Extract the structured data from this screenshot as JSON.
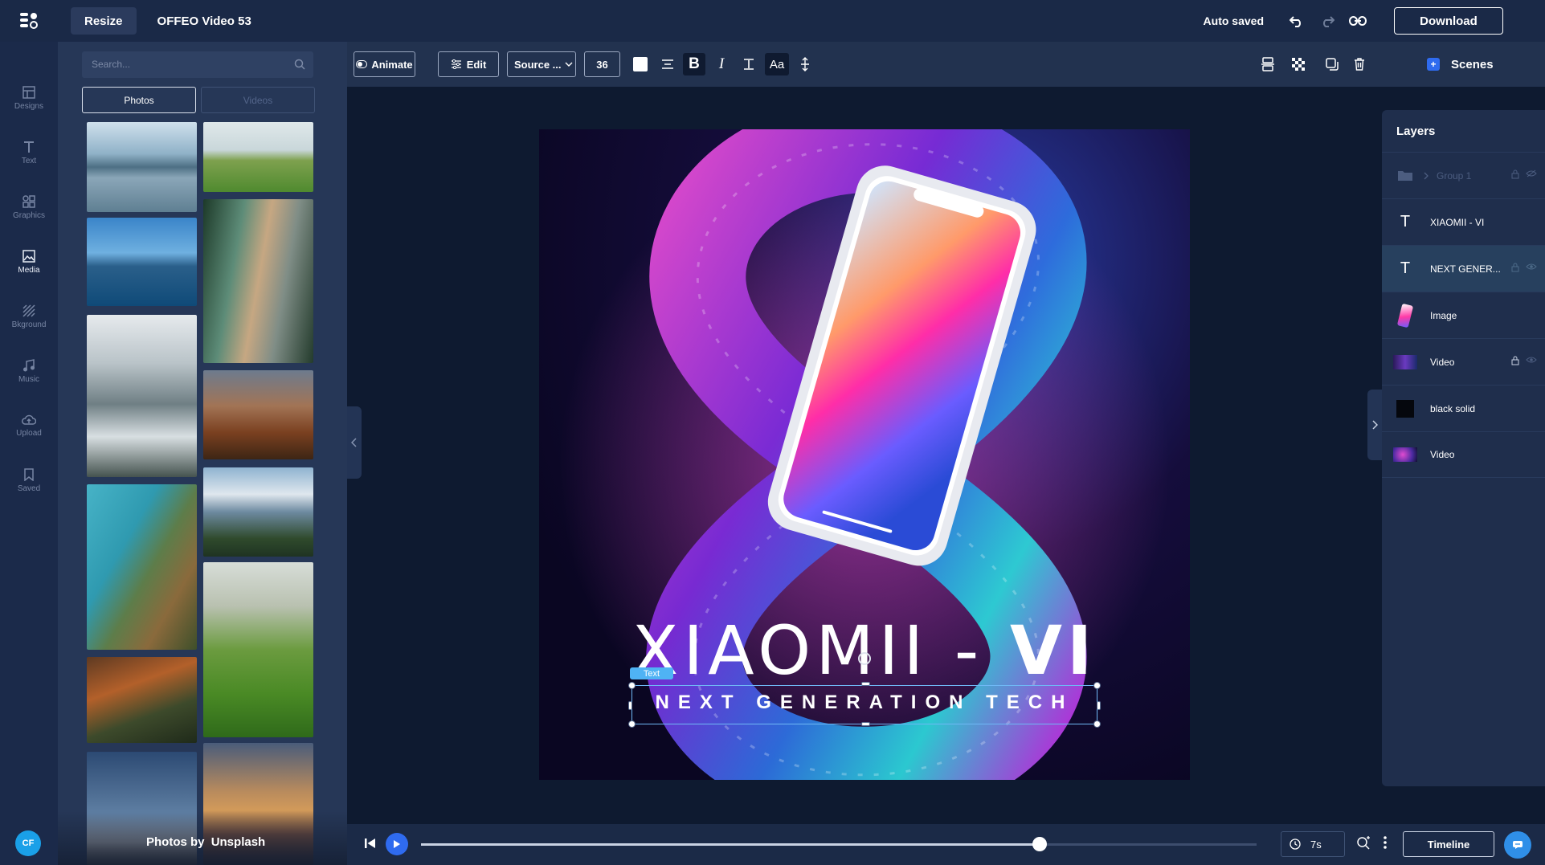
{
  "header": {
    "resize_label": "Resize",
    "project_title": "OFFEO Video 53",
    "autosave_status": "Auto saved",
    "download_label": "Download"
  },
  "rail": {
    "items": [
      {
        "label": "Designs",
        "icon": "layout-icon"
      },
      {
        "label": "Text",
        "icon": "text-icon"
      },
      {
        "label": "Graphics",
        "icon": "shapes-icon"
      },
      {
        "label": "Media",
        "icon": "image-icon"
      },
      {
        "label": "Bkground",
        "icon": "texture-icon"
      },
      {
        "label": "Music",
        "icon": "music-note-icon"
      },
      {
        "label": "Upload",
        "icon": "cloud-upload-icon"
      },
      {
        "label": "Saved",
        "icon": "bookmark-icon"
      }
    ],
    "active": "Media",
    "avatar_initials": "CF"
  },
  "media": {
    "search_placeholder": "Search...",
    "tabs": [
      "Photos",
      "Videos"
    ],
    "active_tab": "Photos",
    "credit_prefix": "Photos by",
    "credit_source": "Unsplash"
  },
  "toolbar": {
    "animate_label": "Animate",
    "edit_label": "Edit",
    "font_family": "Source ...",
    "font_size": "36",
    "scenes_label": "Scenes"
  },
  "canvas": {
    "headline_light": "XIAOMII - ",
    "headline_bold": "VI",
    "subline": "NEXT GENERATION TECH",
    "selected_tag": "Text"
  },
  "layers": {
    "title": "Layers",
    "items": [
      {
        "label": "Group 1",
        "type": "group"
      },
      {
        "label": "XIAOMII - VI",
        "type": "text"
      },
      {
        "label": "NEXT GENER...",
        "type": "text"
      },
      {
        "label": "Image",
        "type": "image"
      },
      {
        "label": "Video",
        "type": "video"
      },
      {
        "label": "black solid",
        "type": "solid"
      },
      {
        "label": "Video",
        "type": "video"
      }
    ]
  },
  "playback": {
    "progress": 0.74,
    "duration": "7s",
    "timeline_label": "Timeline"
  },
  "colors": {
    "accent": "#2f6bef",
    "selection": "#6fb8f5",
    "panel": "#263757",
    "topbar": "#1a2947"
  }
}
